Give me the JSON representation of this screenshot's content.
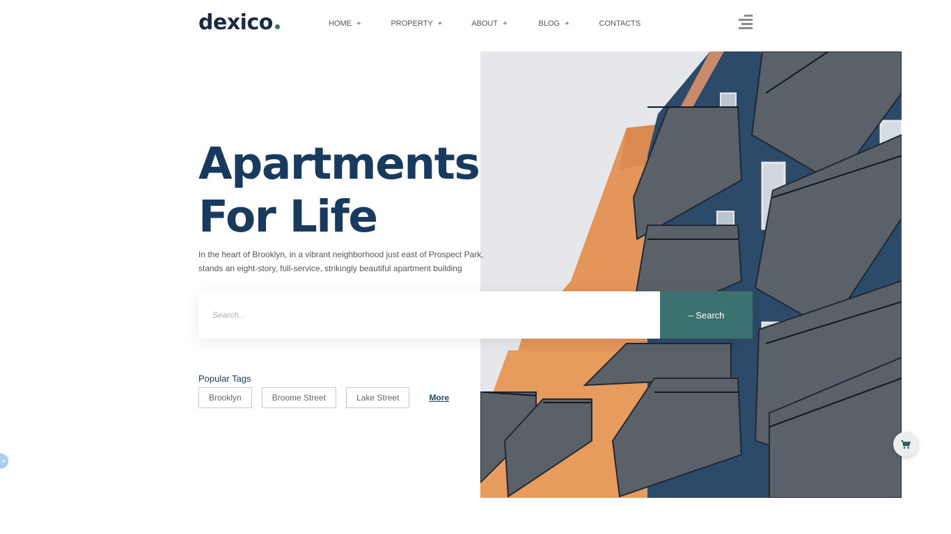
{
  "brand": {
    "logo_text": "dexico",
    "accent_color": "#3c716f",
    "title_color": "#173a5e"
  },
  "nav": {
    "items": [
      {
        "label": "HOME",
        "has_submenu": true,
        "submenu_icon": "+"
      },
      {
        "label": "PROPERTY",
        "has_submenu": true,
        "submenu_icon": "+"
      },
      {
        "label": "ABOUT",
        "has_submenu": true,
        "submenu_icon": "+"
      },
      {
        "label": "BLOG",
        "has_submenu": true,
        "submenu_icon": "+"
      },
      {
        "label": "CONTACTS",
        "has_submenu": false,
        "submenu_icon": ""
      }
    ],
    "menu_icon": "hamburger-menu-icon"
  },
  "hero": {
    "title_line1": "Apartments",
    "title_line2": "For Life",
    "description": "In the heart of Brooklyn, in a vibrant neighborhood just east of Prospect Park, stands an eight-story, full-service, strikingly beautiful apartment building",
    "image_alt": "Apartment building with balconies"
  },
  "search": {
    "placeholder": "Search...",
    "value": "",
    "button_label": "– Search"
  },
  "tags": {
    "label": "Popular Tags",
    "items": [
      "Brooklyn",
      "Broome Street",
      "Lake Street"
    ],
    "more_label": "More"
  },
  "floating": {
    "cart_icon": "cart-icon",
    "side_icon": "filter-icon"
  }
}
